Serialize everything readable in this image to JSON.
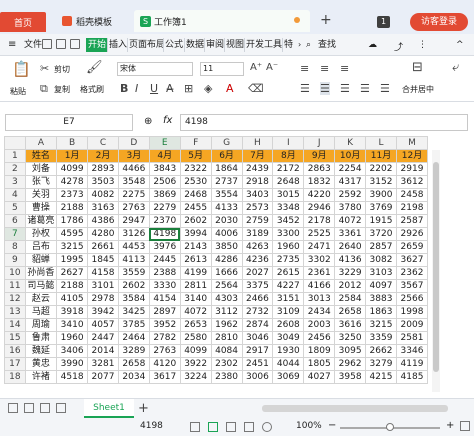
{
  "tabs": {
    "home": "首页",
    "templates": "稻壳模板",
    "workbook": "工作簿1",
    "workbook_icon": "S",
    "new_tab": "+",
    "count_badge": "1",
    "visitor": "访客登录"
  },
  "menu": {
    "file": "文件",
    "items": [
      "开始",
      "插入",
      "页面布局",
      "公式",
      "数据",
      "审阅",
      "视图",
      "开发工具",
      "特"
    ],
    "search": "查找"
  },
  "ribbon": {
    "paste": "粘贴",
    "cut": "剪切",
    "copy": "复制",
    "format_painter": "格式刷",
    "font": "宋体",
    "size": "11",
    "bold": "B",
    "italic": "I",
    "underline": "U",
    "merge_center": "合并居中"
  },
  "formula_bar": {
    "cell_ref": "E7",
    "fx": "fx",
    "value": "4198"
  },
  "grid": {
    "column_letters": [
      "A",
      "B",
      "C",
      "D",
      "E",
      "F",
      "G",
      "H",
      "I",
      "J",
      "K",
      "L",
      "M"
    ],
    "header_row": [
      "姓名",
      "1月",
      "2月",
      "3月",
      "4月",
      "5月",
      "6月",
      "7月",
      "8月",
      "9月",
      "10月",
      "11月",
      "12月"
    ],
    "rows": [
      [
        "刘备",
        "4099",
        "2893",
        "4466",
        "3843",
        "2322",
        "1864",
        "2439",
        "2172",
        "2863",
        "2254",
        "2202",
        "2919"
      ],
      [
        "张飞",
        "4278",
        "3503",
        "3548",
        "2506",
        "2530",
        "2737",
        "2918",
        "2648",
        "1832",
        "4317",
        "3152",
        "3612"
      ],
      [
        "关羽",
        "2373",
        "4082",
        "2275",
        "3869",
        "2468",
        "3554",
        "3403",
        "3015",
        "4220",
        "2592",
        "3900",
        "2458"
      ],
      [
        "曹操",
        "2188",
        "3163",
        "2763",
        "2279",
        "2455",
        "4133",
        "2573",
        "3348",
        "2946",
        "3780",
        "3769",
        "2198"
      ],
      [
        "诸葛亮",
        "1786",
        "4386",
        "2947",
        "2370",
        "2602",
        "2030",
        "2759",
        "3452",
        "2178",
        "4072",
        "1915",
        "2587"
      ],
      [
        "孙权",
        "4595",
        "4280",
        "3126",
        "4198",
        "3994",
        "4006",
        "3189",
        "3300",
        "2525",
        "3361",
        "3720",
        "2926"
      ],
      [
        "吕布",
        "3215",
        "2661",
        "4453",
        "3976",
        "2143",
        "3850",
        "4263",
        "1960",
        "2471",
        "2640",
        "2857",
        "2659"
      ],
      [
        "貂蝉",
        "1995",
        "1845",
        "4113",
        "2445",
        "2613",
        "4286",
        "4236",
        "2735",
        "3302",
        "4136",
        "3082",
        "3627"
      ],
      [
        "孙尚香",
        "2627",
        "4158",
        "3559",
        "2388",
        "4199",
        "1666",
        "2027",
        "2615",
        "2361",
        "3229",
        "3103",
        "2362"
      ],
      [
        "司马懿",
        "2188",
        "3101",
        "2602",
        "3330",
        "2811",
        "2564",
        "3375",
        "4227",
        "4166",
        "2012",
        "4097",
        "3567"
      ],
      [
        "赵云",
        "4105",
        "2978",
        "3584",
        "4154",
        "3140",
        "4303",
        "2466",
        "3151",
        "3013",
        "2584",
        "3883",
        "2566"
      ],
      [
        "马超",
        "3918",
        "3942",
        "3425",
        "2897",
        "4072",
        "3112",
        "2732",
        "3109",
        "2434",
        "2658",
        "1863",
        "1998"
      ],
      [
        "周瑜",
        "3410",
        "4057",
        "3785",
        "3952",
        "2653",
        "1962",
        "2874",
        "2608",
        "2003",
        "3616",
        "3215",
        "2009"
      ],
      [
        "鲁肃",
        "1960",
        "2447",
        "2464",
        "2782",
        "2580",
        "2810",
        "3046",
        "3049",
        "2456",
        "3250",
        "3359",
        "2581"
      ],
      [
        "魏延",
        "3406",
        "2014",
        "3289",
        "2763",
        "4099",
        "4084",
        "2917",
        "1930",
        "1809",
        "3095",
        "2662",
        "3346"
      ],
      [
        "黄忠",
        "3990",
        "3281",
        "2658",
        "4120",
        "3922",
        "2302",
        "2451",
        "4044",
        "1805",
        "2962",
        "3279",
        "4119"
      ],
      [
        "许褚",
        "4518",
        "2077",
        "2034",
        "3617",
        "3224",
        "2380",
        "3006",
        "3069",
        "4027",
        "3958",
        "4215",
        "4185"
      ]
    ]
  },
  "sheet_tabs": {
    "active": "Sheet1",
    "add": "+"
  },
  "status": {
    "value": "4198",
    "zoom": "100%"
  },
  "colors": {
    "accent": "#1aa455",
    "header_fill": "#f5a623",
    "brand_red": "#e24a33"
  }
}
